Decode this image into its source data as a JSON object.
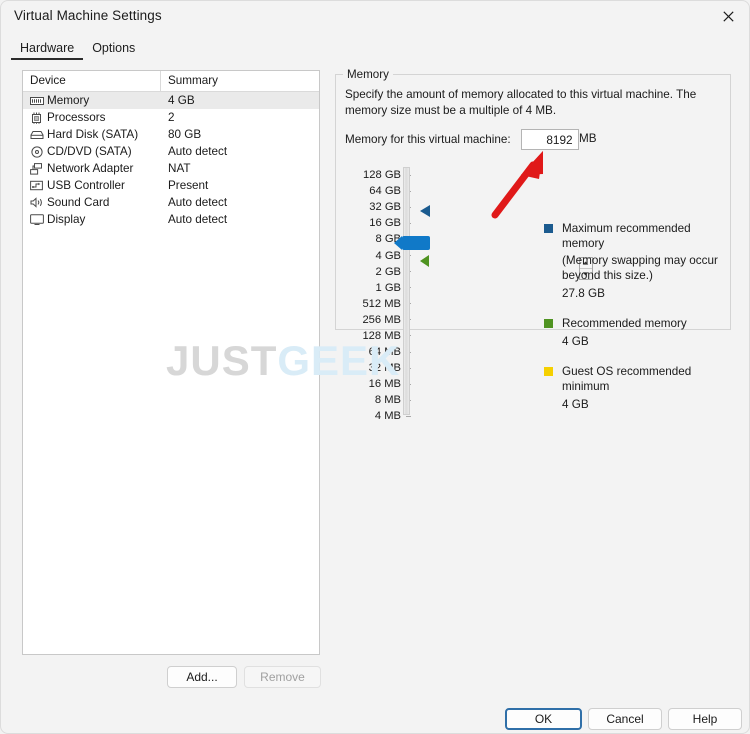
{
  "window": {
    "title": "Virtual Machine Settings",
    "close_icon": "close-icon"
  },
  "tabs": [
    {
      "label": "Hardware",
      "active": true
    },
    {
      "label": "Options",
      "active": false
    }
  ],
  "device_list": {
    "columns": [
      "Device",
      "Summary"
    ],
    "rows": [
      {
        "icon": "memory-icon",
        "device": "Memory",
        "summary": "4 GB",
        "selected": true
      },
      {
        "icon": "cpu-icon",
        "device": "Processors",
        "summary": "2",
        "selected": false
      },
      {
        "icon": "harddisk-icon",
        "device": "Hard Disk (SATA)",
        "summary": "80 GB",
        "selected": false
      },
      {
        "icon": "disc-icon",
        "device": "CD/DVD (SATA)",
        "summary": "Auto detect",
        "selected": false
      },
      {
        "icon": "network-icon",
        "device": "Network Adapter",
        "summary": "NAT",
        "selected": false
      },
      {
        "icon": "usb-icon",
        "device": "USB Controller",
        "summary": "Present",
        "selected": false
      },
      {
        "icon": "speaker-icon",
        "device": "Sound Card",
        "summary": "Auto detect",
        "selected": false
      },
      {
        "icon": "monitor-icon",
        "device": "Display",
        "summary": "Auto detect",
        "selected": false
      }
    ]
  },
  "memory_panel": {
    "group_label": "Memory",
    "description": "Specify the amount of memory allocated to this virtual machine. The memory size must be a multiple of 4 MB.",
    "field_label": "Memory for this virtual machine:",
    "field_value": "8192",
    "field_unit": "MB",
    "spinner_up_icon": "chevron-up-icon",
    "spinner_down_icon": "chevron-down-icon",
    "scale_labels": [
      "128 GB",
      "64 GB",
      "32 GB",
      "16 GB",
      "8 GB",
      "4 GB",
      "2 GB",
      "1 GB",
      "512 MB",
      "256 MB",
      "128 MB",
      "64 MB",
      "32 MB",
      "16 MB",
      "8 MB",
      "4 MB"
    ],
    "slider_handle_position_label": "8 GB",
    "marker_max_position_label": "32 GB",
    "marker_recommended_position_label": "4 GB",
    "colors": {
      "max_recommended": "#1b5b8f",
      "recommended": "#4f9321",
      "guest_minimum": "#f5d000",
      "slider_handle": "#1079c8",
      "annotation_arrow": "#e01919"
    },
    "legend": [
      {
        "swatch": "#1b5b8f",
        "title": "Maximum recommended memory",
        "subtitle": "(Memory swapping may occur beyond this size.)",
        "value": "27.8 GB"
      },
      {
        "swatch": "#4f9321",
        "title": "Recommended memory",
        "subtitle": "",
        "value": "4 GB"
      },
      {
        "swatch": "#f5d000",
        "title": "Guest OS recommended minimum",
        "subtitle": "",
        "value": "4 GB"
      }
    ]
  },
  "list_buttons": {
    "add": "Add...",
    "remove": "Remove"
  },
  "dialog_buttons": {
    "ok": "OK",
    "cancel": "Cancel",
    "help": "Help"
  },
  "watermark": {
    "part1": "JUST",
    "part2": "GEEK"
  }
}
